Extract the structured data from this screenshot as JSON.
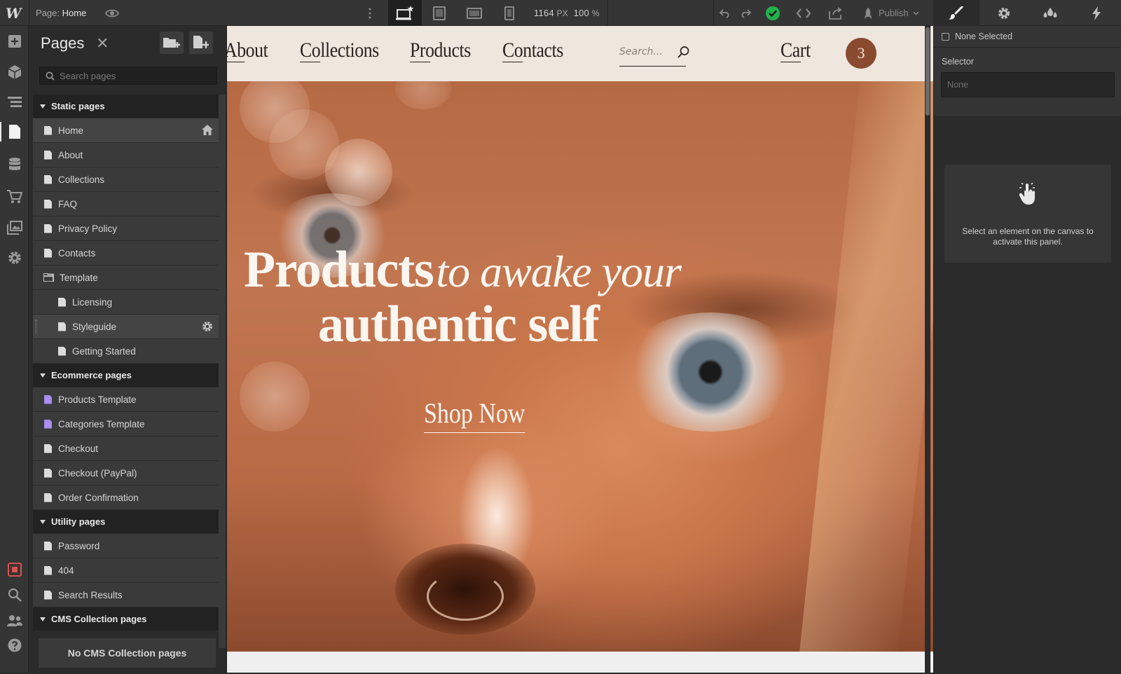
{
  "topbar": {
    "logo": "W",
    "page_prefix": "Page:",
    "page_name": "Home",
    "width_value": "1164",
    "width_unit": "PX",
    "zoom_value": "100",
    "zoom_unit": "%",
    "publish_label": "Publish",
    "status_color": "#22b14c"
  },
  "pages_panel": {
    "title": "Pages",
    "search_placeholder": "Search pages",
    "sections": [
      {
        "label": "Static pages"
      },
      {
        "label": "Ecommerce pages"
      },
      {
        "label": "Utility pages"
      },
      {
        "label": "CMS Collection pages"
      }
    ],
    "static_pages": [
      "Home",
      "About",
      "Collections",
      "FAQ",
      "Privacy Policy",
      "Contacts",
      "Template",
      "Licensing",
      "Styleguide",
      "Getting Started"
    ],
    "ecommerce_pages": [
      "Products Template",
      "Categories Template",
      "Checkout",
      "Checkout (PayPal)",
      "Order Confirmation"
    ],
    "utility_pages": [
      "Password",
      "404",
      "Search Results"
    ],
    "cms_empty": "No CMS Collection pages"
  },
  "site": {
    "nav": {
      "links": [
        "About",
        "Collections",
        "Products",
        "Contacts"
      ],
      "search_placeholder": "Search...",
      "cart_label": "Cart",
      "cart_count": "3",
      "accent": "#8a4a30"
    },
    "hero": {
      "headline_bold_1": "Products",
      "headline_italic": "to awake your",
      "headline_bold_2": "authentic self",
      "cta": "Shop Now"
    }
  },
  "right_panel": {
    "none_selected": "None Selected",
    "selector_label": "Selector",
    "selector_placeholder": "None",
    "empty_message": "Select an element on the canvas to activate this panel."
  }
}
